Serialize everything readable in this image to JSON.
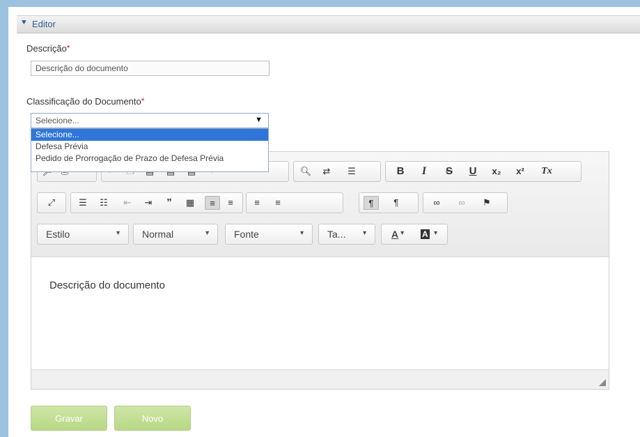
{
  "panel": {
    "title": "Editor"
  },
  "descricao": {
    "label": "Descrição",
    "required": "*",
    "value": "Descrição do documento"
  },
  "classificacao": {
    "label": "Classificação do Documento",
    "required": "*",
    "selected": "Selecione...",
    "options": [
      "Selecione...",
      "Defesa Prévia",
      "Pedido de Prorrogação de Prazo de Defesa Prévia"
    ]
  },
  "toolbar": {
    "row1": {
      "text_buttons": [
        "B",
        "I",
        "S",
        "U",
        "x₂",
        "x²",
        "Tx"
      ]
    },
    "row3": {
      "style": "Estilo",
      "format": "Normal",
      "font": "Fonte",
      "size": "Ta...",
      "text_color": "A",
      "bg_color": "A"
    }
  },
  "editor": {
    "content": "Descrição do documento"
  },
  "buttons": {
    "save": "Gravar",
    "new": "Novo"
  },
  "colors": {
    "accent": "#2b5f94",
    "selection": "#2f76d8",
    "button": "#bcd98c",
    "frame": "#9cc2e0"
  }
}
